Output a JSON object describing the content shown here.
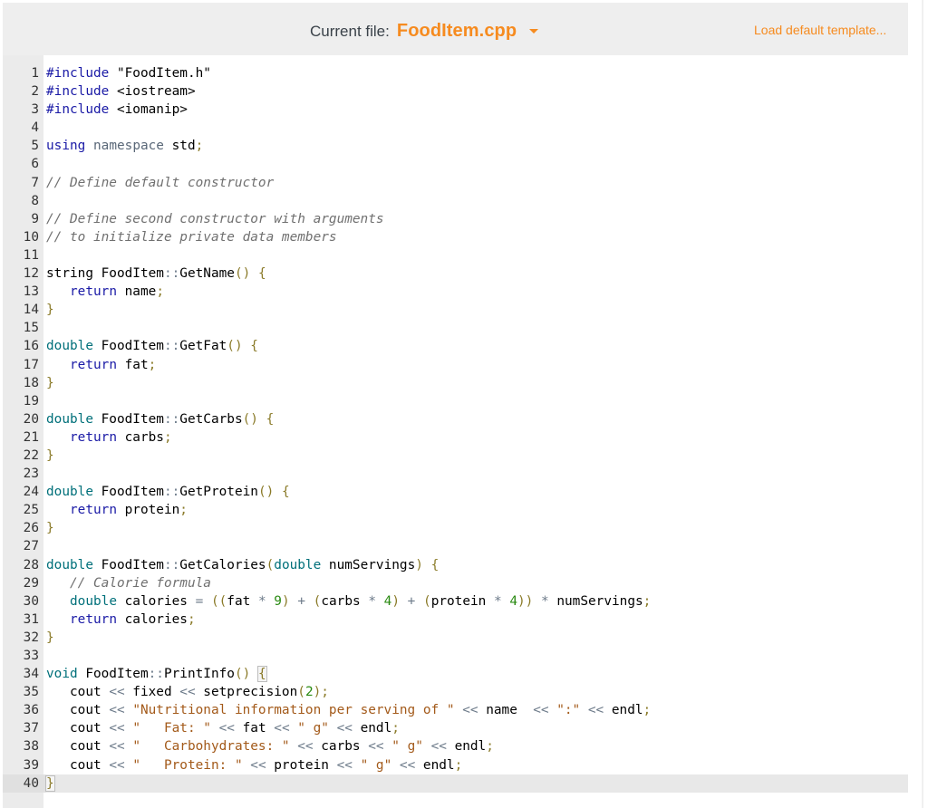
{
  "toolbar": {
    "current_file_label": "Current file:",
    "current_file_name": "FoodItem.cpp",
    "dropdown_icon": "caret-down-icon",
    "load_template_label": "Load default template..."
  },
  "colors": {
    "accent": "#f68b1f",
    "toolbar_bg": "#eeeeee",
    "gutter_bg": "#ebebeb",
    "keyword": "#1a1aa6",
    "type": "#00707a",
    "comment": "#707070",
    "string": "#a35a1a",
    "number": "#2a8a12"
  },
  "editor": {
    "active_line": 40,
    "lines": [
      {
        "n": "1",
        "tokens": [
          {
            "t": "kw",
            "v": "#include"
          },
          {
            "t": "",
            "v": " \"FoodItem.h\""
          }
        ]
      },
      {
        "n": "2",
        "tokens": [
          {
            "t": "kw",
            "v": "#include"
          },
          {
            "t": "",
            "v": " <iostream>"
          }
        ]
      },
      {
        "n": "3",
        "tokens": [
          {
            "t": "kw",
            "v": "#include"
          },
          {
            "t": "",
            "v": " <iomanip>"
          }
        ]
      },
      {
        "n": "4",
        "tokens": []
      },
      {
        "n": "5",
        "tokens": [
          {
            "t": "kw",
            "v": "using"
          },
          {
            "t": "",
            "v": " "
          },
          {
            "t": "ns",
            "v": "namespace"
          },
          {
            "t": "",
            "v": " std"
          },
          {
            "t": "br",
            "v": ";"
          }
        ]
      },
      {
        "n": "6",
        "tokens": []
      },
      {
        "n": "7",
        "tokens": [
          {
            "t": "cm",
            "v": "// Define default constructor"
          }
        ]
      },
      {
        "n": "8",
        "tokens": []
      },
      {
        "n": "9",
        "tokens": [
          {
            "t": "cm",
            "v": "// Define second constructor with arguments"
          }
        ]
      },
      {
        "n": "10",
        "tokens": [
          {
            "t": "cm",
            "v": "// to initialize private data members"
          }
        ]
      },
      {
        "n": "11",
        "tokens": []
      },
      {
        "n": "12",
        "tokens": [
          {
            "t": "",
            "v": "string FoodItem"
          },
          {
            "t": "op",
            "v": "::"
          },
          {
            "t": "",
            "v": "GetName"
          },
          {
            "t": "br",
            "v": "()"
          },
          {
            "t": "",
            "v": " "
          },
          {
            "t": "br",
            "v": "{"
          }
        ]
      },
      {
        "n": "13",
        "tokens": [
          {
            "t": "",
            "v": "   "
          },
          {
            "t": "kw",
            "v": "return"
          },
          {
            "t": "",
            "v": " name"
          },
          {
            "t": "br",
            "v": ";"
          }
        ]
      },
      {
        "n": "14",
        "tokens": [
          {
            "t": "br",
            "v": "}"
          }
        ]
      },
      {
        "n": "15",
        "tokens": []
      },
      {
        "n": "16",
        "tokens": [
          {
            "t": "ty",
            "v": "double"
          },
          {
            "t": "",
            "v": " FoodItem"
          },
          {
            "t": "op",
            "v": "::"
          },
          {
            "t": "",
            "v": "GetFat"
          },
          {
            "t": "br",
            "v": "()"
          },
          {
            "t": "",
            "v": " "
          },
          {
            "t": "br",
            "v": "{"
          }
        ]
      },
      {
        "n": "17",
        "tokens": [
          {
            "t": "",
            "v": "   "
          },
          {
            "t": "kw",
            "v": "return"
          },
          {
            "t": "",
            "v": " fat"
          },
          {
            "t": "br",
            "v": ";"
          }
        ]
      },
      {
        "n": "18",
        "tokens": [
          {
            "t": "br",
            "v": "}"
          }
        ]
      },
      {
        "n": "19",
        "tokens": []
      },
      {
        "n": "20",
        "tokens": [
          {
            "t": "ty",
            "v": "double"
          },
          {
            "t": "",
            "v": " FoodItem"
          },
          {
            "t": "op",
            "v": "::"
          },
          {
            "t": "",
            "v": "GetCarbs"
          },
          {
            "t": "br",
            "v": "()"
          },
          {
            "t": "",
            "v": " "
          },
          {
            "t": "br",
            "v": "{"
          }
        ]
      },
      {
        "n": "21",
        "tokens": [
          {
            "t": "",
            "v": "   "
          },
          {
            "t": "kw",
            "v": "return"
          },
          {
            "t": "",
            "v": " carbs"
          },
          {
            "t": "br",
            "v": ";"
          }
        ]
      },
      {
        "n": "22",
        "tokens": [
          {
            "t": "br",
            "v": "}"
          }
        ]
      },
      {
        "n": "23",
        "tokens": []
      },
      {
        "n": "24",
        "tokens": [
          {
            "t": "ty",
            "v": "double"
          },
          {
            "t": "",
            "v": " FoodItem"
          },
          {
            "t": "op",
            "v": "::"
          },
          {
            "t": "",
            "v": "GetProtein"
          },
          {
            "t": "br",
            "v": "()"
          },
          {
            "t": "",
            "v": " "
          },
          {
            "t": "br",
            "v": "{"
          }
        ]
      },
      {
        "n": "25",
        "tokens": [
          {
            "t": "",
            "v": "   "
          },
          {
            "t": "kw",
            "v": "return"
          },
          {
            "t": "",
            "v": " protein"
          },
          {
            "t": "br",
            "v": ";"
          }
        ]
      },
      {
        "n": "26",
        "tokens": [
          {
            "t": "br",
            "v": "}"
          }
        ]
      },
      {
        "n": "27",
        "tokens": []
      },
      {
        "n": "28",
        "tokens": [
          {
            "t": "ty",
            "v": "double"
          },
          {
            "t": "",
            "v": " FoodItem"
          },
          {
            "t": "op",
            "v": "::"
          },
          {
            "t": "",
            "v": "GetCalories"
          },
          {
            "t": "br",
            "v": "("
          },
          {
            "t": "ty",
            "v": "double"
          },
          {
            "t": "",
            "v": " numServings"
          },
          {
            "t": "br",
            "v": ")"
          },
          {
            "t": "",
            "v": " "
          },
          {
            "t": "br",
            "v": "{"
          }
        ]
      },
      {
        "n": "29",
        "tokens": [
          {
            "t": "",
            "v": "   "
          },
          {
            "t": "cm",
            "v": "// Calorie formula"
          }
        ]
      },
      {
        "n": "30",
        "tokens": [
          {
            "t": "",
            "v": "   "
          },
          {
            "t": "ty",
            "v": "double"
          },
          {
            "t": "",
            "v": " calories "
          },
          {
            "t": "op",
            "v": "="
          },
          {
            "t": "",
            "v": " "
          },
          {
            "t": "br",
            "v": "(("
          },
          {
            "t": "",
            "v": "fat "
          },
          {
            "t": "op",
            "v": "*"
          },
          {
            "t": "",
            "v": " "
          },
          {
            "t": "num",
            "v": "9"
          },
          {
            "t": "br",
            "v": ")"
          },
          {
            "t": "",
            "v": " "
          },
          {
            "t": "op",
            "v": "+"
          },
          {
            "t": "",
            "v": " "
          },
          {
            "t": "br",
            "v": "("
          },
          {
            "t": "",
            "v": "carbs "
          },
          {
            "t": "op",
            "v": "*"
          },
          {
            "t": "",
            "v": " "
          },
          {
            "t": "num",
            "v": "4"
          },
          {
            "t": "br",
            "v": ")"
          },
          {
            "t": "",
            "v": " "
          },
          {
            "t": "op",
            "v": "+"
          },
          {
            "t": "",
            "v": " "
          },
          {
            "t": "br",
            "v": "("
          },
          {
            "t": "",
            "v": "protein "
          },
          {
            "t": "op",
            "v": "*"
          },
          {
            "t": "",
            "v": " "
          },
          {
            "t": "num",
            "v": "4"
          },
          {
            "t": "br",
            "v": "))"
          },
          {
            "t": "",
            "v": " "
          },
          {
            "t": "op",
            "v": "*"
          },
          {
            "t": "",
            "v": " numServings"
          },
          {
            "t": "br",
            "v": ";"
          }
        ]
      },
      {
        "n": "31",
        "tokens": [
          {
            "t": "",
            "v": "   "
          },
          {
            "t": "kw",
            "v": "return"
          },
          {
            "t": "",
            "v": " calories"
          },
          {
            "t": "br",
            "v": ";"
          }
        ]
      },
      {
        "n": "32",
        "tokens": [
          {
            "t": "br",
            "v": "}"
          }
        ]
      },
      {
        "n": "33",
        "tokens": []
      },
      {
        "n": "34",
        "tokens": [
          {
            "t": "ty",
            "v": "void"
          },
          {
            "t": "",
            "v": " FoodItem"
          },
          {
            "t": "op",
            "v": "::"
          },
          {
            "t": "",
            "v": "PrintInfo"
          },
          {
            "t": "br",
            "v": "()"
          },
          {
            "t": "",
            "v": " "
          },
          {
            "t": "br box",
            "v": "{"
          }
        ]
      },
      {
        "n": "35",
        "tokens": [
          {
            "t": "",
            "v": "   cout "
          },
          {
            "t": "op",
            "v": "<<"
          },
          {
            "t": "",
            "v": " fixed "
          },
          {
            "t": "op",
            "v": "<<"
          },
          {
            "t": "",
            "v": " setprecision"
          },
          {
            "t": "br",
            "v": "("
          },
          {
            "t": "num",
            "v": "2"
          },
          {
            "t": "br",
            "v": ")"
          },
          {
            "t": "br",
            "v": ";"
          }
        ]
      },
      {
        "n": "36",
        "tokens": [
          {
            "t": "",
            "v": "   cout "
          },
          {
            "t": "op",
            "v": "<<"
          },
          {
            "t": "",
            "v": " "
          },
          {
            "t": "str",
            "v": "\"Nutritional information per serving of \""
          },
          {
            "t": "",
            "v": " "
          },
          {
            "t": "op",
            "v": "<<"
          },
          {
            "t": "",
            "v": " name  "
          },
          {
            "t": "op",
            "v": "<<"
          },
          {
            "t": "",
            "v": " "
          },
          {
            "t": "str",
            "v": "\":\""
          },
          {
            "t": "",
            "v": " "
          },
          {
            "t": "op",
            "v": "<<"
          },
          {
            "t": "",
            "v": " endl"
          },
          {
            "t": "br",
            "v": ";"
          }
        ]
      },
      {
        "n": "37",
        "tokens": [
          {
            "t": "",
            "v": "   cout "
          },
          {
            "t": "op",
            "v": "<<"
          },
          {
            "t": "",
            "v": " "
          },
          {
            "t": "str",
            "v": "\"   Fat: \""
          },
          {
            "t": "",
            "v": " "
          },
          {
            "t": "op",
            "v": "<<"
          },
          {
            "t": "",
            "v": " fat "
          },
          {
            "t": "op",
            "v": "<<"
          },
          {
            "t": "",
            "v": " "
          },
          {
            "t": "str",
            "v": "\" g\""
          },
          {
            "t": "",
            "v": " "
          },
          {
            "t": "op",
            "v": "<<"
          },
          {
            "t": "",
            "v": " endl"
          },
          {
            "t": "br",
            "v": ";"
          }
        ]
      },
      {
        "n": "38",
        "tokens": [
          {
            "t": "",
            "v": "   cout "
          },
          {
            "t": "op",
            "v": "<<"
          },
          {
            "t": "",
            "v": " "
          },
          {
            "t": "str",
            "v": "\"   Carbohydrates: \""
          },
          {
            "t": "",
            "v": " "
          },
          {
            "t": "op",
            "v": "<<"
          },
          {
            "t": "",
            "v": " carbs "
          },
          {
            "t": "op",
            "v": "<<"
          },
          {
            "t": "",
            "v": " "
          },
          {
            "t": "str",
            "v": "\" g\""
          },
          {
            "t": "",
            "v": " "
          },
          {
            "t": "op",
            "v": "<<"
          },
          {
            "t": "",
            "v": " endl"
          },
          {
            "t": "br",
            "v": ";"
          }
        ]
      },
      {
        "n": "39",
        "tokens": [
          {
            "t": "",
            "v": "   cout "
          },
          {
            "t": "op",
            "v": "<<"
          },
          {
            "t": "",
            "v": " "
          },
          {
            "t": "str",
            "v": "\"   Protein: \""
          },
          {
            "t": "",
            "v": " "
          },
          {
            "t": "op",
            "v": "<<"
          },
          {
            "t": "",
            "v": " protein "
          },
          {
            "t": "op",
            "v": "<<"
          },
          {
            "t": "",
            "v": " "
          },
          {
            "t": "str",
            "v": "\" g\""
          },
          {
            "t": "",
            "v": " "
          },
          {
            "t": "op",
            "v": "<<"
          },
          {
            "t": "",
            "v": " endl"
          },
          {
            "t": "br",
            "v": ";"
          }
        ]
      },
      {
        "n": "40",
        "tokens": [
          {
            "t": "br box",
            "v": "}"
          }
        ]
      }
    ]
  }
}
